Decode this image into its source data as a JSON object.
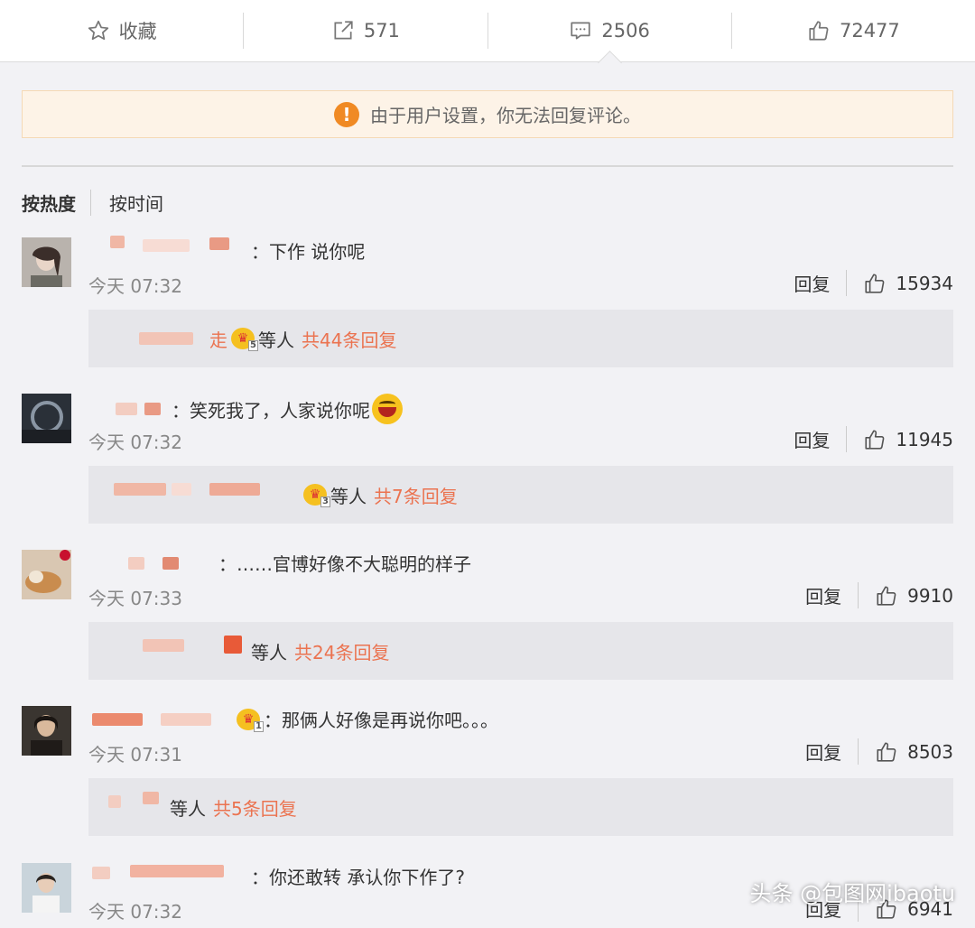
{
  "topbar": {
    "favorite": {
      "icon": "star-icon",
      "label": "收藏"
    },
    "share": {
      "icon": "share-icon",
      "label": "571"
    },
    "comment": {
      "icon": "comment-icon",
      "label": "2506"
    },
    "like": {
      "icon": "thumbs-up-icon",
      "label": "72477"
    }
  },
  "notice": {
    "icon": "warning-icon",
    "text": "由于用户设置，你无法回复评论。"
  },
  "sort": {
    "by_hot": "按热度",
    "by_time": "按时间"
  },
  "comments": [
    {
      "name_suffix": "：",
      "text": "下作 说你呢",
      "time": "今天 07:32",
      "reply": "回复",
      "likes": "15934",
      "sub": {
        "name_tail": "走",
        "after": "等人",
        "more": "共44条回复"
      }
    },
    {
      "name_suffix": "：",
      "text": "笑死我了，人家说你呢",
      "time": "今天 07:32",
      "reply": "回复",
      "likes": "11945",
      "sub": {
        "name_tail": "",
        "after": "等人",
        "more": "共7条回复"
      }
    },
    {
      "name_suffix": "：",
      "text": "……官博好像不大聪明的样子",
      "time": "今天 07:33",
      "reply": "回复",
      "likes": "9910",
      "sub": {
        "name_tail": "",
        "after": "等人",
        "more": "共24条回复"
      }
    },
    {
      "name_suffix": "：",
      "text": "那俩人好像是再说你吧。。。",
      "time": "今天 07:31",
      "reply": "回复",
      "likes": "8503",
      "sub": {
        "name_tail": "",
        "after": "等人",
        "more": "共5条回复"
      }
    },
    {
      "name_suffix": "：",
      "text": "你还敢转 承认你下作了?",
      "time": "今天 07:32",
      "reply": "回复",
      "likes": "6941"
    }
  ],
  "watermark": "头条 @包图网ibaotu",
  "colors": {
    "accent": "#eb7350",
    "warning": "#f08a24",
    "notice_bg": "#fdf3e7"
  }
}
